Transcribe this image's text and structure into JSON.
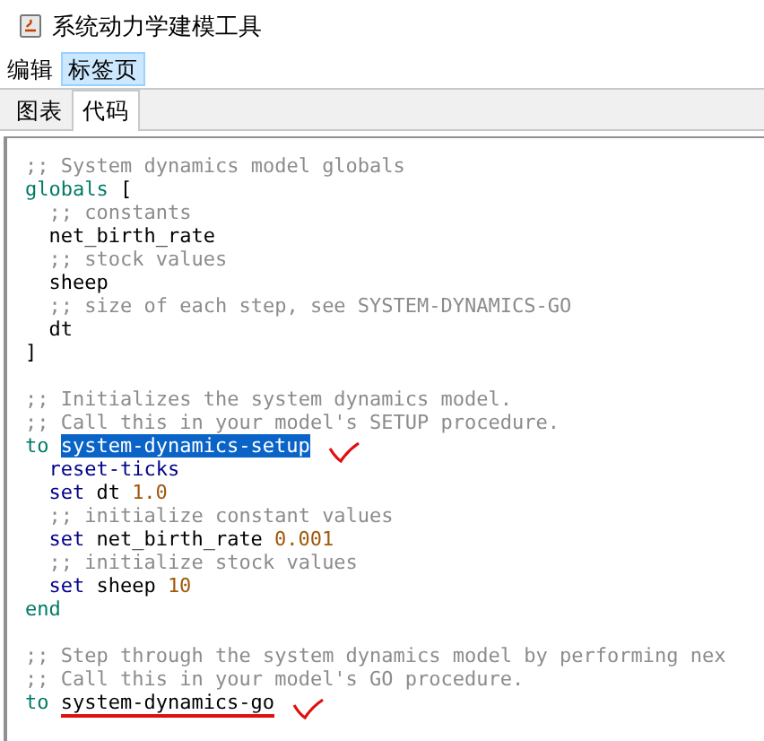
{
  "window": {
    "title": "系统动力学建模工具"
  },
  "menu": [
    {
      "label": "编辑",
      "selected": false
    },
    {
      "label": "标签页",
      "selected": true
    }
  ],
  "tabs": [
    {
      "label": "图表",
      "selected": false
    },
    {
      "label": "代码",
      "selected": true
    }
  ],
  "code_lines": [
    {
      "check_mark": false,
      "tokens": [
        {
          "text": ";; System dynamics model globals",
          "kind": "comment"
        }
      ]
    },
    {
      "check_mark": false,
      "tokens": [
        {
          "text": "globals",
          "kind": "keyword"
        },
        {
          "text": " [",
          "kind": "plain"
        }
      ]
    },
    {
      "check_mark": false,
      "tokens": [
        {
          "text": "  ;; constants",
          "kind": "comment"
        }
      ]
    },
    {
      "check_mark": false,
      "tokens": [
        {
          "text": "  net_birth_rate",
          "kind": "plain"
        }
      ]
    },
    {
      "check_mark": false,
      "tokens": [
        {
          "text": "  ;; stock values",
          "kind": "comment"
        }
      ]
    },
    {
      "check_mark": false,
      "tokens": [
        {
          "text": "  sheep",
          "kind": "plain"
        }
      ]
    },
    {
      "check_mark": false,
      "tokens": [
        {
          "text": "  ;; size of each step, see SYSTEM-DYNAMICS-GO",
          "kind": "comment"
        }
      ]
    },
    {
      "check_mark": false,
      "tokens": [
        {
          "text": "  dt",
          "kind": "plain"
        }
      ]
    },
    {
      "check_mark": false,
      "tokens": [
        {
          "text": "]",
          "kind": "plain"
        }
      ]
    },
    {
      "check_mark": false
    },
    {
      "check_mark": false,
      "tokens": [
        {
          "text": ";; Initializes the system dynamics model.",
          "kind": "comment"
        }
      ]
    },
    {
      "check_mark": false,
      "tokens": [
        {
          "text": ";; Call this in your model's SETUP procedure.",
          "kind": "comment"
        }
      ]
    },
    {
      "check_mark": true,
      "tokens": [
        {
          "text": "to",
          "kind": "keyword"
        },
        {
          "text": "system-dynamics-setup",
          "kind": "selection"
        }
      ]
    },
    {
      "check_mark": false,
      "tokens": [
        {
          "text": "  reset-ticks",
          "kind": "command"
        }
      ]
    },
    {
      "check_mark": false,
      "tokens": [
        {
          "text": "  set",
          "kind": "command"
        },
        {
          "text": "dt",
          "kind": "plain"
        },
        {
          "text": "1.0",
          "kind": "number"
        }
      ]
    },
    {
      "check_mark": false,
      "tokens": [
        {
          "text": "  ;; initialize constant values",
          "kind": "comment"
        }
      ]
    },
    {
      "check_mark": false,
      "tokens": [
        {
          "text": "  set",
          "kind": "command"
        },
        {
          "text": "net_birth_rate",
          "kind": "plain"
        },
        {
          "text": "0.001",
          "kind": "number"
        }
      ]
    },
    {
      "check_mark": false,
      "tokens": [
        {
          "text": "  ;; initialize stock values",
          "kind": "comment"
        }
      ]
    },
    {
      "check_mark": false,
      "tokens": [
        {
          "text": "  set",
          "kind": "command"
        },
        {
          "text": "sheep",
          "kind": "plain"
        },
        {
          "text": "10",
          "kind": "number"
        }
      ]
    },
    {
      "check_mark": false,
      "tokens": [
        {
          "text": "end",
          "kind": "keyword"
        }
      ]
    },
    {
      "check_mark": false
    },
    {
      "check_mark": false,
      "tokens": [
        {
          "text": ";; Step through the system dynamics model by performing nex",
          "kind": "comment"
        }
      ]
    },
    {
      "check_mark": false,
      "tokens": [
        {
          "text": ";; Call this in your model's GO procedure.",
          "kind": "comment"
        }
      ]
    },
    {
      "check_mark": true,
      "tokens": [
        {
          "text": "to",
          "kind": "keyword"
        },
        {
          "text": "system-dynamics-go",
          "kind": "underlined"
        }
      ]
    }
  ]
}
